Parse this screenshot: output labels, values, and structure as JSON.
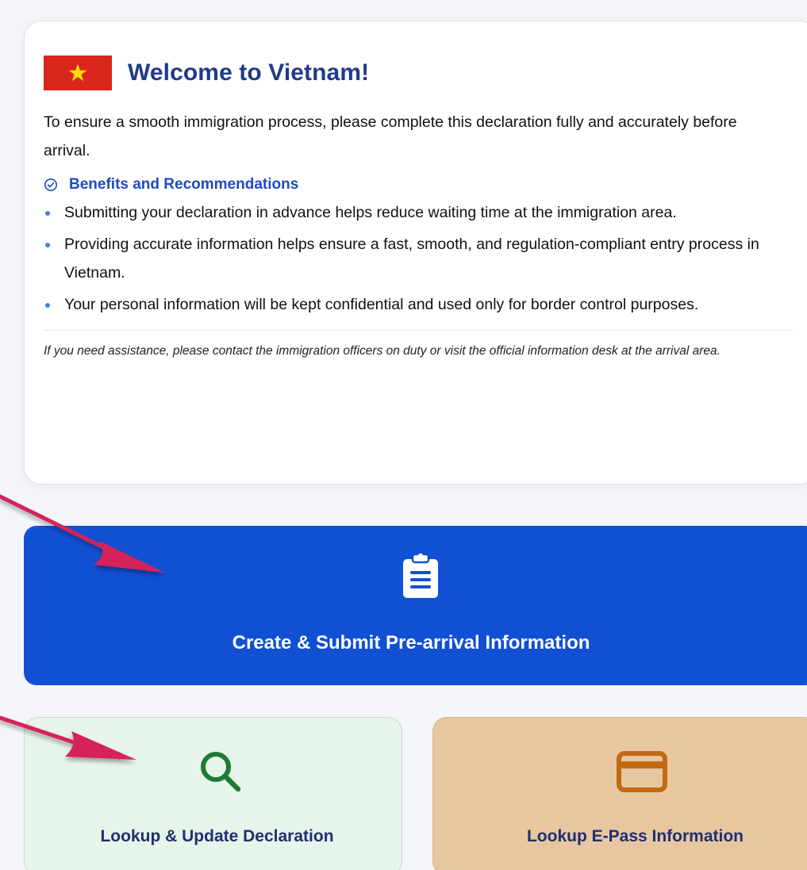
{
  "welcome": {
    "title": "Welcome to Vietnam!",
    "intro": "To ensure a smooth immigration process, please complete this declaration fully and accurately before arrival.",
    "benefits_heading": "Benefits and Recommendations",
    "benefits": [
      "Submitting your declaration in advance helps reduce waiting time at the immigration area.",
      "Providing accurate information helps ensure a fast, smooth, and regulation-compliant entry process in Vietnam.",
      "Your personal information will be kept confidential and used only for border control purposes."
    ],
    "note": "If you need assistance, please contact the immigration officers on duty or visit the official information desk at the arrival area.",
    "flag_icon": "vietnam-flag-icon"
  },
  "actions": {
    "create": {
      "label": "Create & Submit Pre-arrival Information",
      "icon": "clipboard-icon",
      "color": "#1150d3"
    },
    "lookup": {
      "label": "Lookup & Update Declaration",
      "icon": "search-icon",
      "color": "#e6f4ea"
    },
    "epass": {
      "label": "Lookup E-Pass Information",
      "icon": "card-icon",
      "color": "#e8c7a0"
    }
  },
  "colors": {
    "primary": "#1150d3",
    "title": "#1e3a8a",
    "accent": "#1f49c7",
    "annotation_arrow": "#d6245a"
  }
}
